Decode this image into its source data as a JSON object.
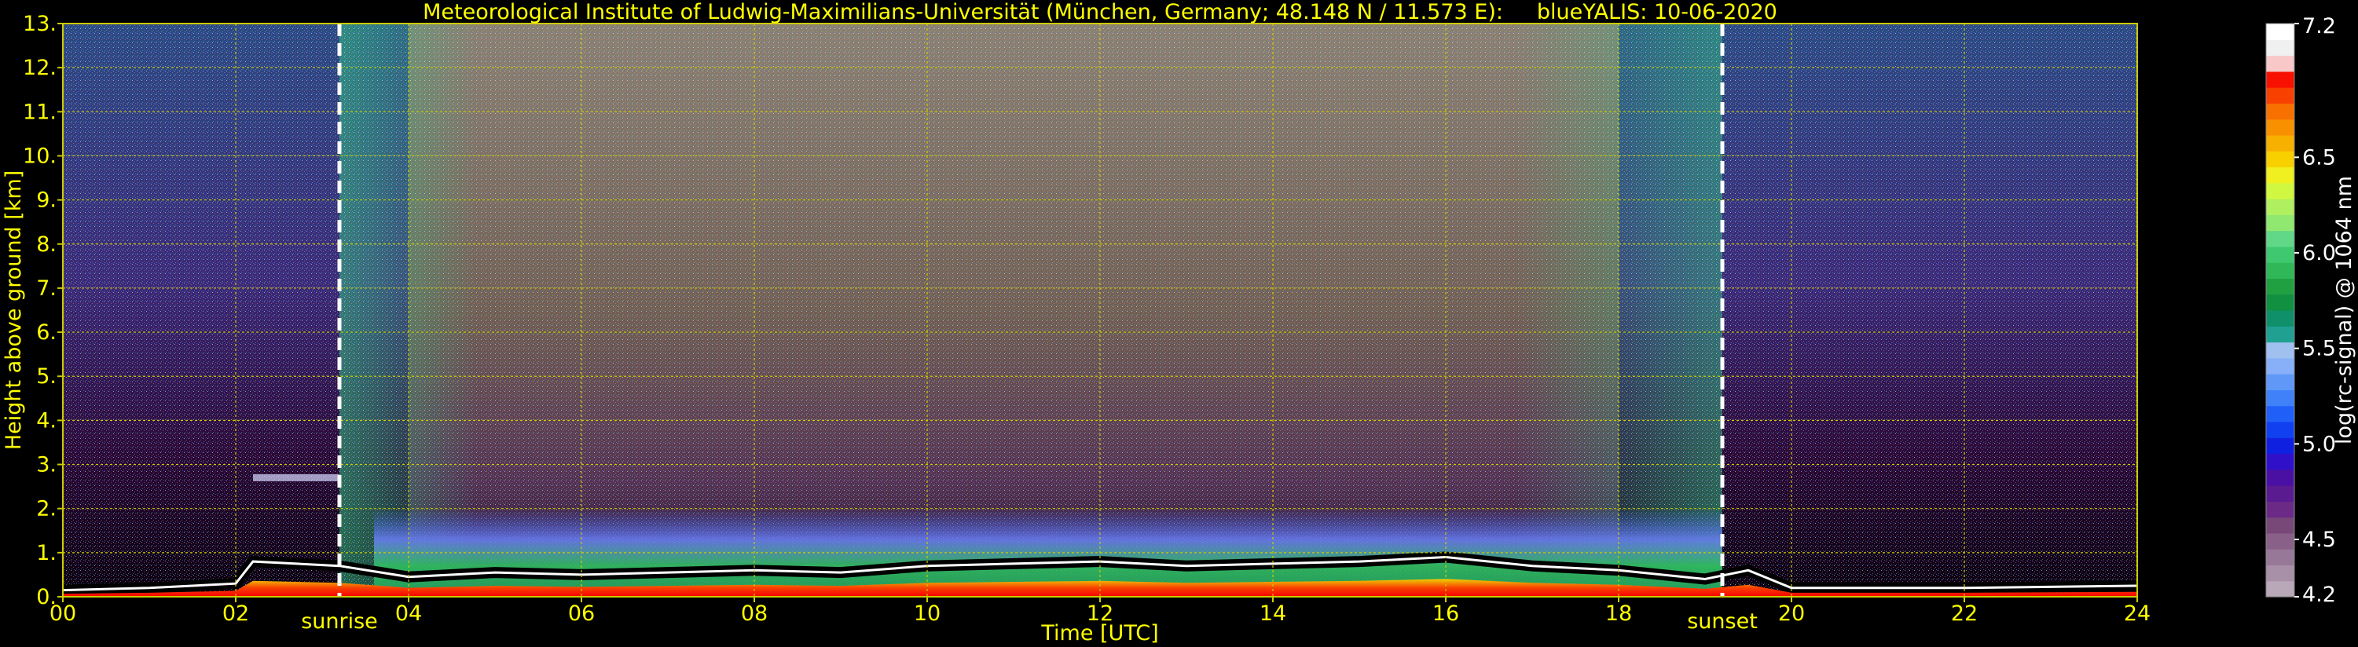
{
  "chart_data": {
    "type": "heatmap",
    "title": "Meteorological Institute of Ludwig-Maximilians-Universität (München, Germany; 48.148 N / 11.573 E):     blueYALIS: 10-06-2020",
    "xlabel": "Time [UTC]",
    "ylabel": "Height above ground [km]",
    "xlim": [
      0,
      24
    ],
    "ylim": [
      0,
      13
    ],
    "x_ticks": [
      {
        "value": 0,
        "label": "00"
      },
      {
        "value": 2,
        "label": "02"
      },
      {
        "value": 4,
        "label": "04"
      },
      {
        "value": 6,
        "label": "06"
      },
      {
        "value": 8,
        "label": "08"
      },
      {
        "value": 10,
        "label": "10"
      },
      {
        "value": 12,
        "label": "12"
      },
      {
        "value": 14,
        "label": "14"
      },
      {
        "value": 16,
        "label": "16"
      },
      {
        "value": 18,
        "label": "18"
      },
      {
        "value": 20,
        "label": "20"
      },
      {
        "value": 22,
        "label": "22"
      },
      {
        "value": 24,
        "label": "24"
      }
    ],
    "y_ticks": [
      {
        "value": 0,
        "label": "0."
      },
      {
        "value": 1,
        "label": "1."
      },
      {
        "value": 2,
        "label": "2."
      },
      {
        "value": 3,
        "label": "3."
      },
      {
        "value": 4,
        "label": "4."
      },
      {
        "value": 5,
        "label": "5."
      },
      {
        "value": 6,
        "label": "6."
      },
      {
        "value": 7,
        "label": "7."
      },
      {
        "value": 8,
        "label": "8."
      },
      {
        "value": 9,
        "label": "9."
      },
      {
        "value": 10,
        "label": "10."
      },
      {
        "value": 11,
        "label": "11."
      },
      {
        "value": 12,
        "label": "12."
      },
      {
        "value": 13,
        "label": "13."
      }
    ],
    "grid": true,
    "markers": [
      {
        "label": "sunrise",
        "time": 3.2
      },
      {
        "label": "sunset",
        "time": 19.2
      }
    ],
    "colorbar": {
      "label": "log(rc-signal) @ 1064 nm",
      "range": [
        4.2,
        7.2
      ],
      "ticks": [
        {
          "value": 4.2,
          "label": "4.2"
        },
        {
          "value": 4.5,
          "label": "4.5"
        },
        {
          "value": 5.0,
          "label": "5.0"
        },
        {
          "value": 5.5,
          "label": "5.5"
        },
        {
          "value": 6.0,
          "label": "6.0"
        },
        {
          "value": 6.5,
          "label": "6.5"
        },
        {
          "value": 7.2,
          "label": "7.2"
        }
      ],
      "colors": [
        "#b8a8b8",
        "#a890a8",
        "#987898",
        "#886088",
        "#784878",
        "#6a2a86",
        "#5a1a90",
        "#4a10a4",
        "#3010c8",
        "#1020e0",
        "#1040f0",
        "#2060f8",
        "#4080f8",
        "#6098f8",
        "#88b0f8",
        "#a0c0f0",
        "#20a090",
        "#10906a",
        "#109040",
        "#20a040",
        "#30b858",
        "#40c870",
        "#60d888",
        "#90e870",
        "#b0f060",
        "#d0f840",
        "#f0f020",
        "#f8d000",
        "#f8b000",
        "#f89000",
        "#f87000",
        "#f84000",
        "#f81000",
        "#f8c8c8",
        "#f0f0f0",
        "#ffffff"
      ]
    },
    "features": {
      "boundary_layer_top_km": [
        [
          0.0,
          0.15
        ],
        [
          1.0,
          0.2
        ],
        [
          2.0,
          0.3
        ],
        [
          2.2,
          0.8
        ],
        [
          3.2,
          0.7
        ],
        [
          4.0,
          0.45
        ],
        [
          5.0,
          0.55
        ],
        [
          6.0,
          0.5
        ],
        [
          7.0,
          0.55
        ],
        [
          8.0,
          0.6
        ],
        [
          9.0,
          0.55
        ],
        [
          10.0,
          0.7
        ],
        [
          11.0,
          0.75
        ],
        [
          12.0,
          0.8
        ],
        [
          13.0,
          0.7
        ],
        [
          14.0,
          0.75
        ],
        [
          15.0,
          0.8
        ],
        [
          16.0,
          0.9
        ],
        [
          17.0,
          0.7
        ],
        [
          18.0,
          0.6
        ],
        [
          19.0,
          0.4
        ],
        [
          19.5,
          0.6
        ],
        [
          20.0,
          0.2
        ],
        [
          22.0,
          0.2
        ],
        [
          24.0,
          0.25
        ]
      ],
      "aerosol_layer_top_km": 2.0,
      "elevated_layer_km": 2.7,
      "elevated_layer_hours": [
        2.2,
        3.2
      ]
    }
  }
}
